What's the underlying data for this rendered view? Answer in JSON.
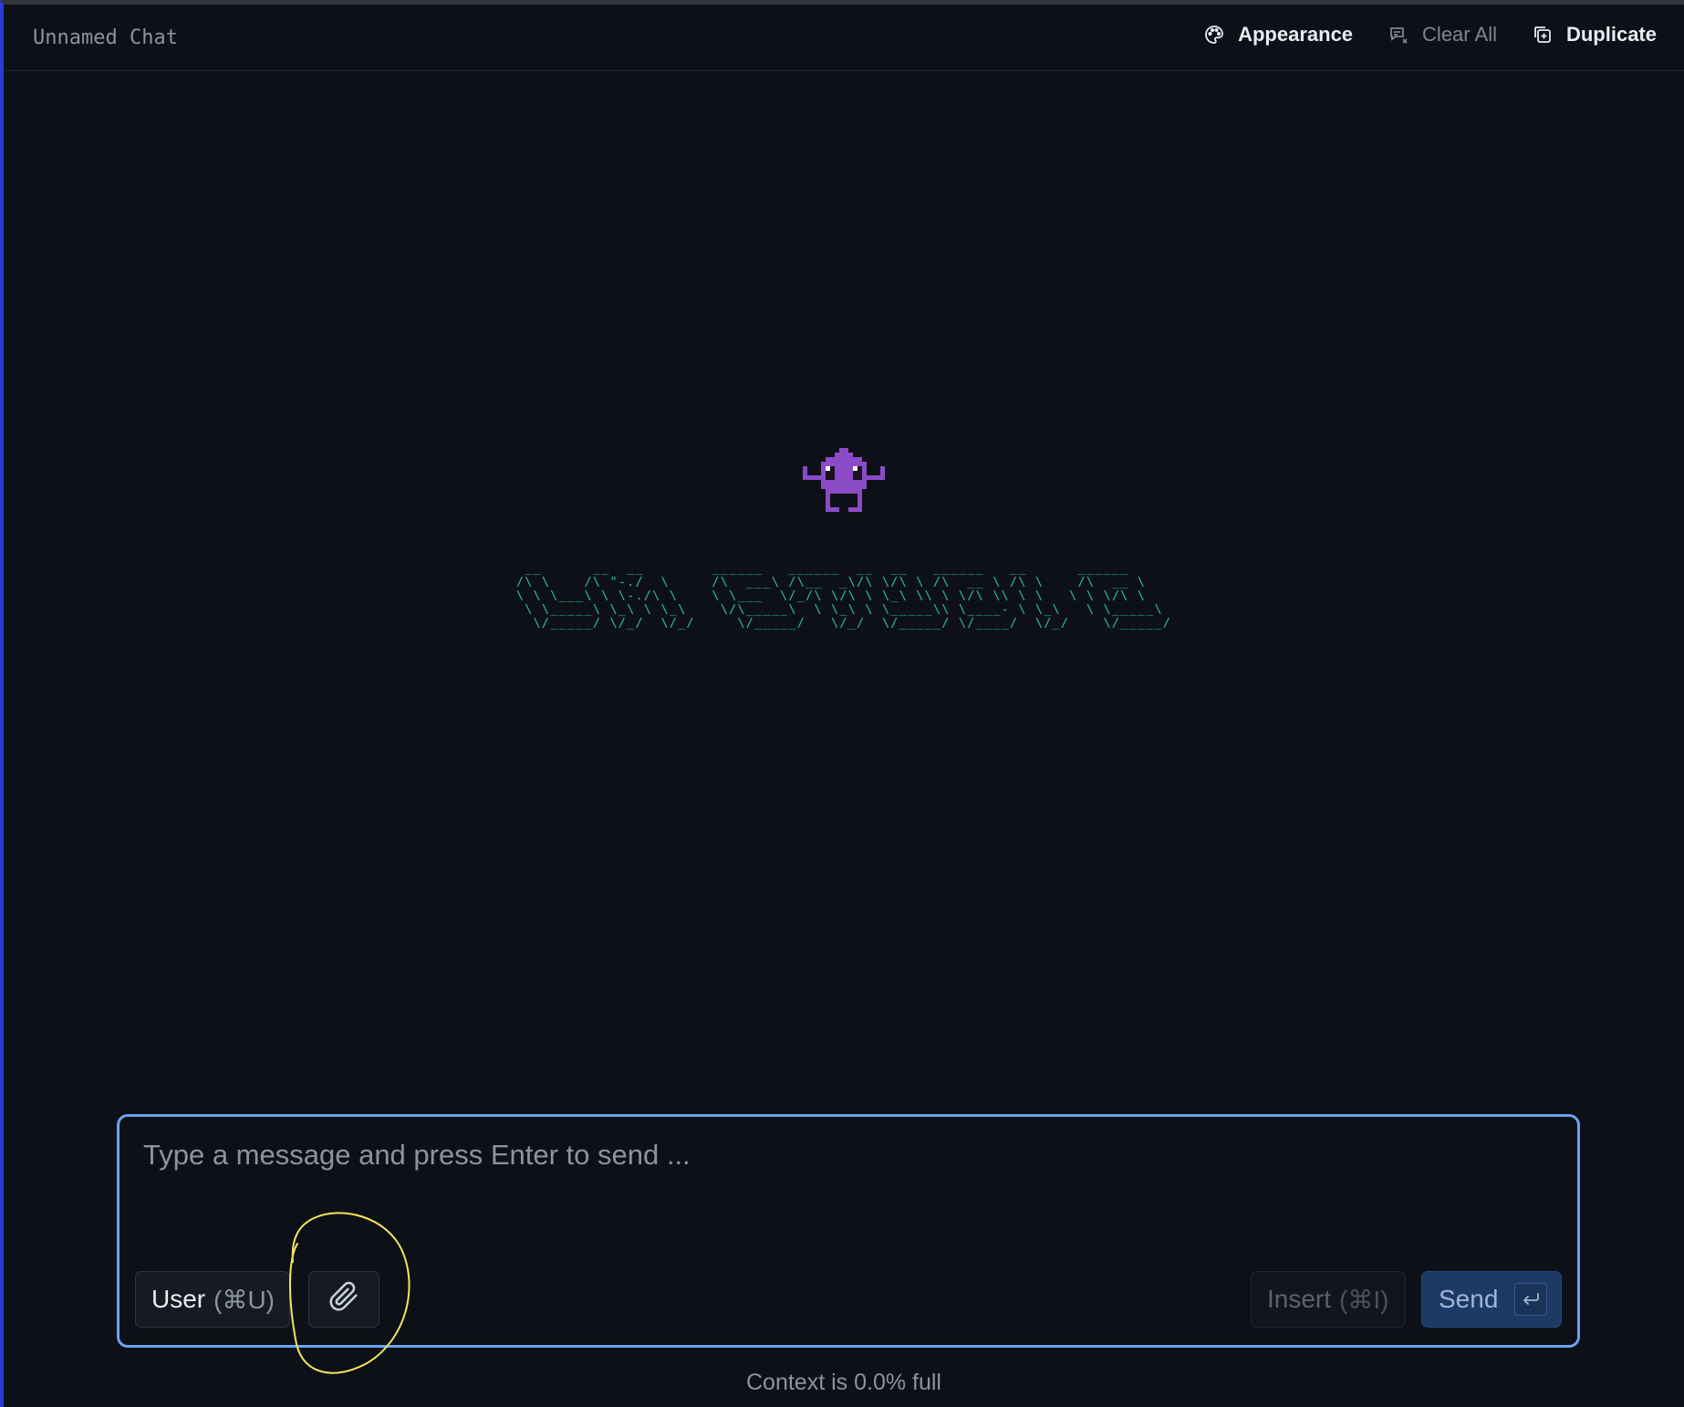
{
  "header": {
    "chat_title": "Unnamed Chat",
    "actions": {
      "appearance": "Appearance",
      "clear_all": "Clear All",
      "duplicate": "Duplicate"
    }
  },
  "splash": {
    "logo_icon": "alien-icon",
    "banner_ascii": " __      __  __        ______   ______  __  __   ______   __      ______\n/\\ \\    /\\ \"-./  \\     /\\  ___\\ /\\__  _\\/\\ \\/\\ \\ /\\  __ \\ /\\ \\    /\\  __ \\\n\\ \\ \\___\\ \\ \\-./\\ \\    \\ \\___  \\/_/\\ \\/\\ \\ \\_\\ \\\\ \\ \\/\\ \\\\ \\ \\   \\ \\ \\/\\ \\\n \\ \\_____\\ \\_\\ \\ \\_\\    \\/\\_____\\  \\ \\_\\ \\ \\_____\\\\ \\____- \\ \\_\\   \\ \\_____\\\n  \\/_____/ \\/_/  \\/_/     \\/_____/   \\/_/  \\/_____/ \\/____/  \\/_/    \\/_____/",
    "accent_color": "#2dbd9a",
    "alien_color": "#8b4bc6"
  },
  "composer": {
    "placeholder": "Type a message and press Enter to send ...",
    "value": "",
    "role_button_label": "User",
    "role_button_shortcut": "(⌘U)",
    "attach_icon": "paperclip-icon",
    "insert_label": "Insert",
    "insert_shortcut": "(⌘I)",
    "send_label": "Send",
    "send_key_icon": "enter-key-icon",
    "focus_border_color": "#6ba3f0"
  },
  "annotation": {
    "highlight_color": "#f2e55c"
  },
  "footer": {
    "context_text": "Context is 0.0% full"
  }
}
